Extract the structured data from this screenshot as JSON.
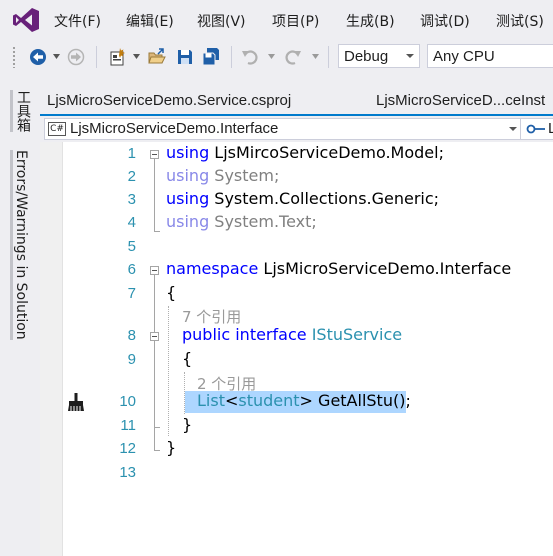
{
  "menu": {
    "items": [
      "文件(F)",
      "编辑(E)",
      "视图(V)",
      "项目(P)",
      "生成(B)",
      "调试(D)",
      "测试(S)"
    ]
  },
  "toolbar": {
    "config_value": "Debug",
    "platform_value": "Any CPU"
  },
  "side_panels": {
    "toolbox": "工具箱",
    "errors": "Errors/Warnings in Solution"
  },
  "tabs": {
    "tab1": "LjsMicroServiceDemo.Service.csproj",
    "tab2": "LjsMicroServiceD...ceInst"
  },
  "navbar": {
    "cs_badge": "C#",
    "scope": "LjsMicroServiceDemo.Interface",
    "member_prefix": "L"
  },
  "editor": {
    "line_numbers": [
      "1",
      "2",
      "3",
      "4",
      "5",
      "6",
      "7",
      "8",
      "9",
      "10",
      "11",
      "12",
      "13"
    ],
    "lines": {
      "l1": {
        "kw": "using",
        "text": " LjsMircoServiceDemo.Model;"
      },
      "l2": {
        "kw": "using",
        "text": " System;"
      },
      "l3": {
        "kw": "using",
        "text": " System.Collections.Generic;"
      },
      "l4": {
        "kw": "using",
        "text": " System.Text;"
      },
      "l6": {
        "kw": "namespace",
        "text": " LjsMicroServiceDemo.Interface"
      },
      "l7": {
        "text": "{"
      },
      "lens1": "7 个引用",
      "l8": {
        "kw": "public interface",
        "type": "IStuService"
      },
      "l9": {
        "text": "{"
      },
      "lens2": "2 个引用",
      "l10": {
        "type1": "List",
        "lt": "<",
        "type2": "student",
        "gt": ">",
        "method": " GetAllStu();"
      },
      "l11": {
        "text": "}"
      },
      "l12": {
        "text": "}"
      }
    }
  },
  "colors": {
    "keyword": "#0000ff",
    "type": "#2b91af",
    "line_number": "#2b91af",
    "selection": "#add6ff",
    "accent": "#007acc"
  }
}
